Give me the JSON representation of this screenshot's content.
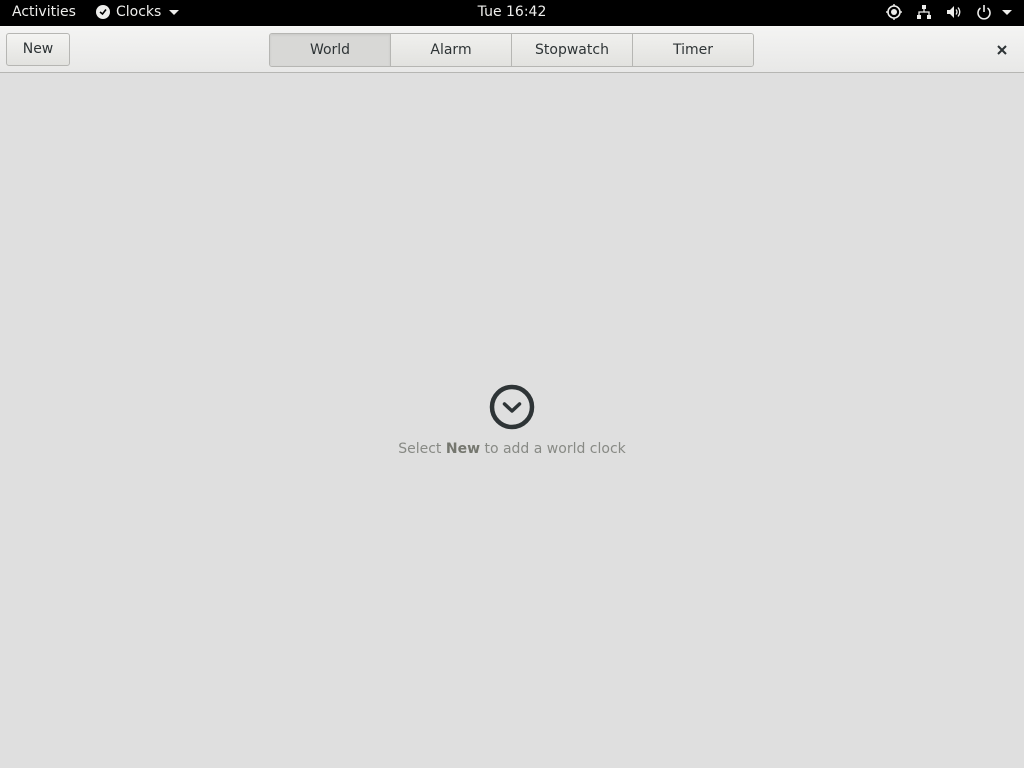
{
  "topbar": {
    "activities": "Activities",
    "app_name": "Clocks",
    "clock": "Tue 16:42",
    "status_icons": [
      "location-icon",
      "network-icon",
      "volume-icon",
      "power-icon"
    ]
  },
  "header": {
    "new_label": "New",
    "tabs": [
      {
        "label": "World",
        "active": true
      },
      {
        "label": "Alarm",
        "active": false
      },
      {
        "label": "Stopwatch",
        "active": false
      },
      {
        "label": "Timer",
        "active": false
      }
    ],
    "close_icon": "close-icon"
  },
  "main": {
    "empty_icon": "clock-icon",
    "empty_prefix": "Select ",
    "empty_bold": "New",
    "empty_suffix": " to add a world clock"
  },
  "colors": {
    "topbar_bg": "#000000",
    "window_bg": "#dfdfdf",
    "text": "#2e3436",
    "dim_text": "#888a85"
  }
}
